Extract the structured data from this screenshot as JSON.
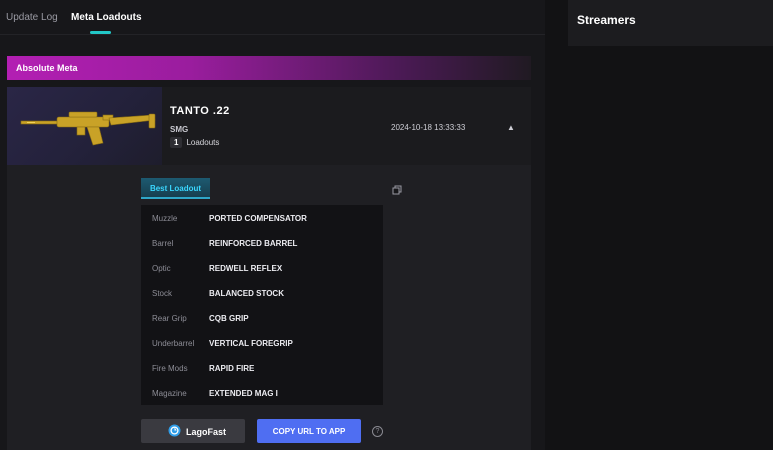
{
  "tabs": [
    {
      "label": "Update Log",
      "active": false
    },
    {
      "label": "Meta Loadouts",
      "active": true
    }
  ],
  "right_panel": {
    "title": "Streamers"
  },
  "section": {
    "title": "Absolute Meta"
  },
  "weapon": {
    "name": "TANTO .22",
    "class": "SMG",
    "loadout_count": "1",
    "loadouts_label": "Loadouts",
    "timestamp": "2024-10-18 13:33:33"
  },
  "best_loadout_label": "Best Loadout",
  "attachments": [
    {
      "slot": "Muzzle",
      "value": "PORTED COMPENSATOR"
    },
    {
      "slot": "Barrel",
      "value": "REINFORCED BARREL"
    },
    {
      "slot": "Optic",
      "value": "REDWELL REFLEX"
    },
    {
      "slot": "Stock",
      "value": "BALANCED STOCK"
    },
    {
      "slot": "Rear Grip",
      "value": "CQB GRIP"
    },
    {
      "slot": "Underbarrel",
      "value": "VERTICAL FOREGRIP"
    },
    {
      "slot": "Fire Mods",
      "value": "RAPID FIRE"
    },
    {
      "slot": "Magazine",
      "value": "EXTENDED MAG I"
    }
  ],
  "buttons": {
    "lagofast": "LagoFast",
    "copy_url": "COPY URL TO APP"
  },
  "colors": {
    "accent_cyan": "#22c7c7",
    "banner_magenta": "#b31fb3",
    "copy_button_blue": "#4f6ef2",
    "weapon_gold": "#c9a227"
  },
  "icons": {
    "collapse": "chevron-up-icon",
    "copy": "copy-icon",
    "help": "question-circle-icon",
    "lagofast": "lagofast-logo-icon"
  }
}
